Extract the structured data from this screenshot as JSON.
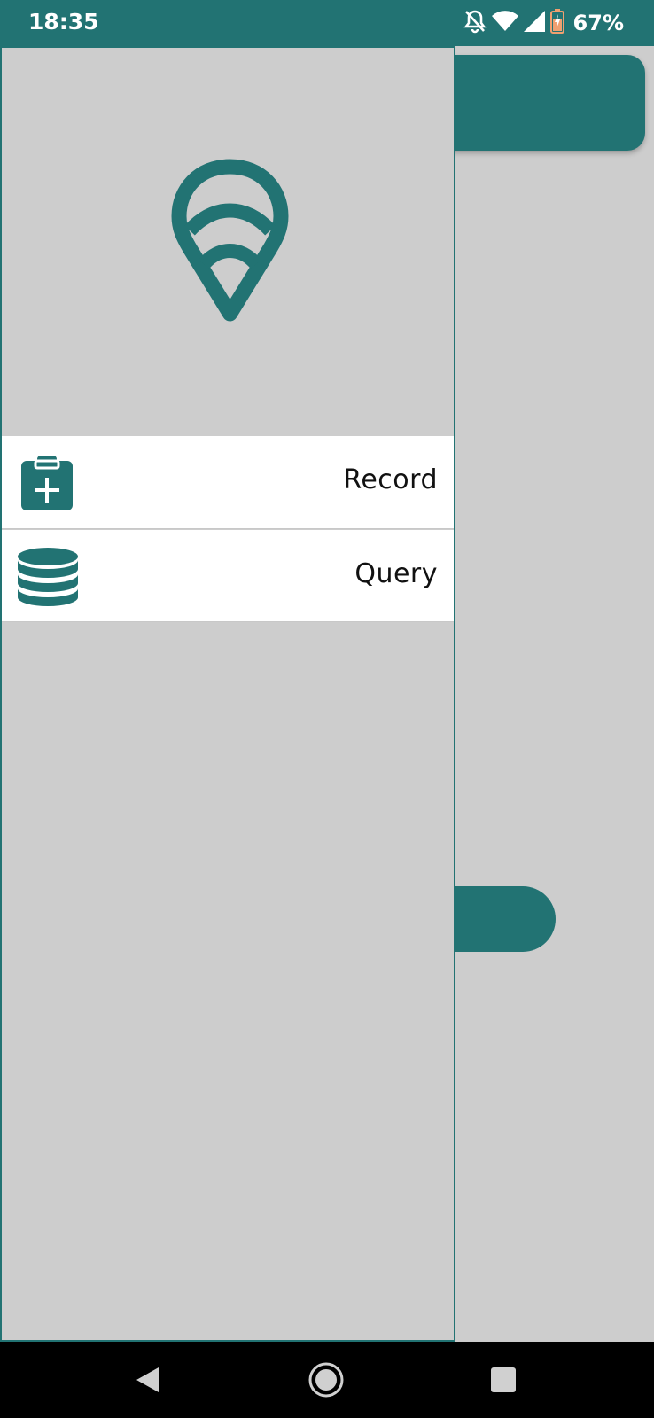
{
  "status_bar": {
    "time": "18:35",
    "battery_percent": "67%",
    "icons": [
      "notifications-off-icon",
      "wifi-icon",
      "cell-signal-icon",
      "battery-icon"
    ]
  },
  "drawer": {
    "logo_icon": "location-pin-wifi-icon",
    "menu_items": [
      {
        "label": "Record",
        "icon": "clipboard-add-icon"
      },
      {
        "label": "Query",
        "icon": "database-icon"
      }
    ]
  },
  "navigation_bar": {
    "buttons": [
      "back-icon",
      "home-icon",
      "recents-icon"
    ]
  },
  "colors": {
    "accent": "#227373",
    "background": "#cdcdcd",
    "menu_item_bg": "#ffffff"
  }
}
